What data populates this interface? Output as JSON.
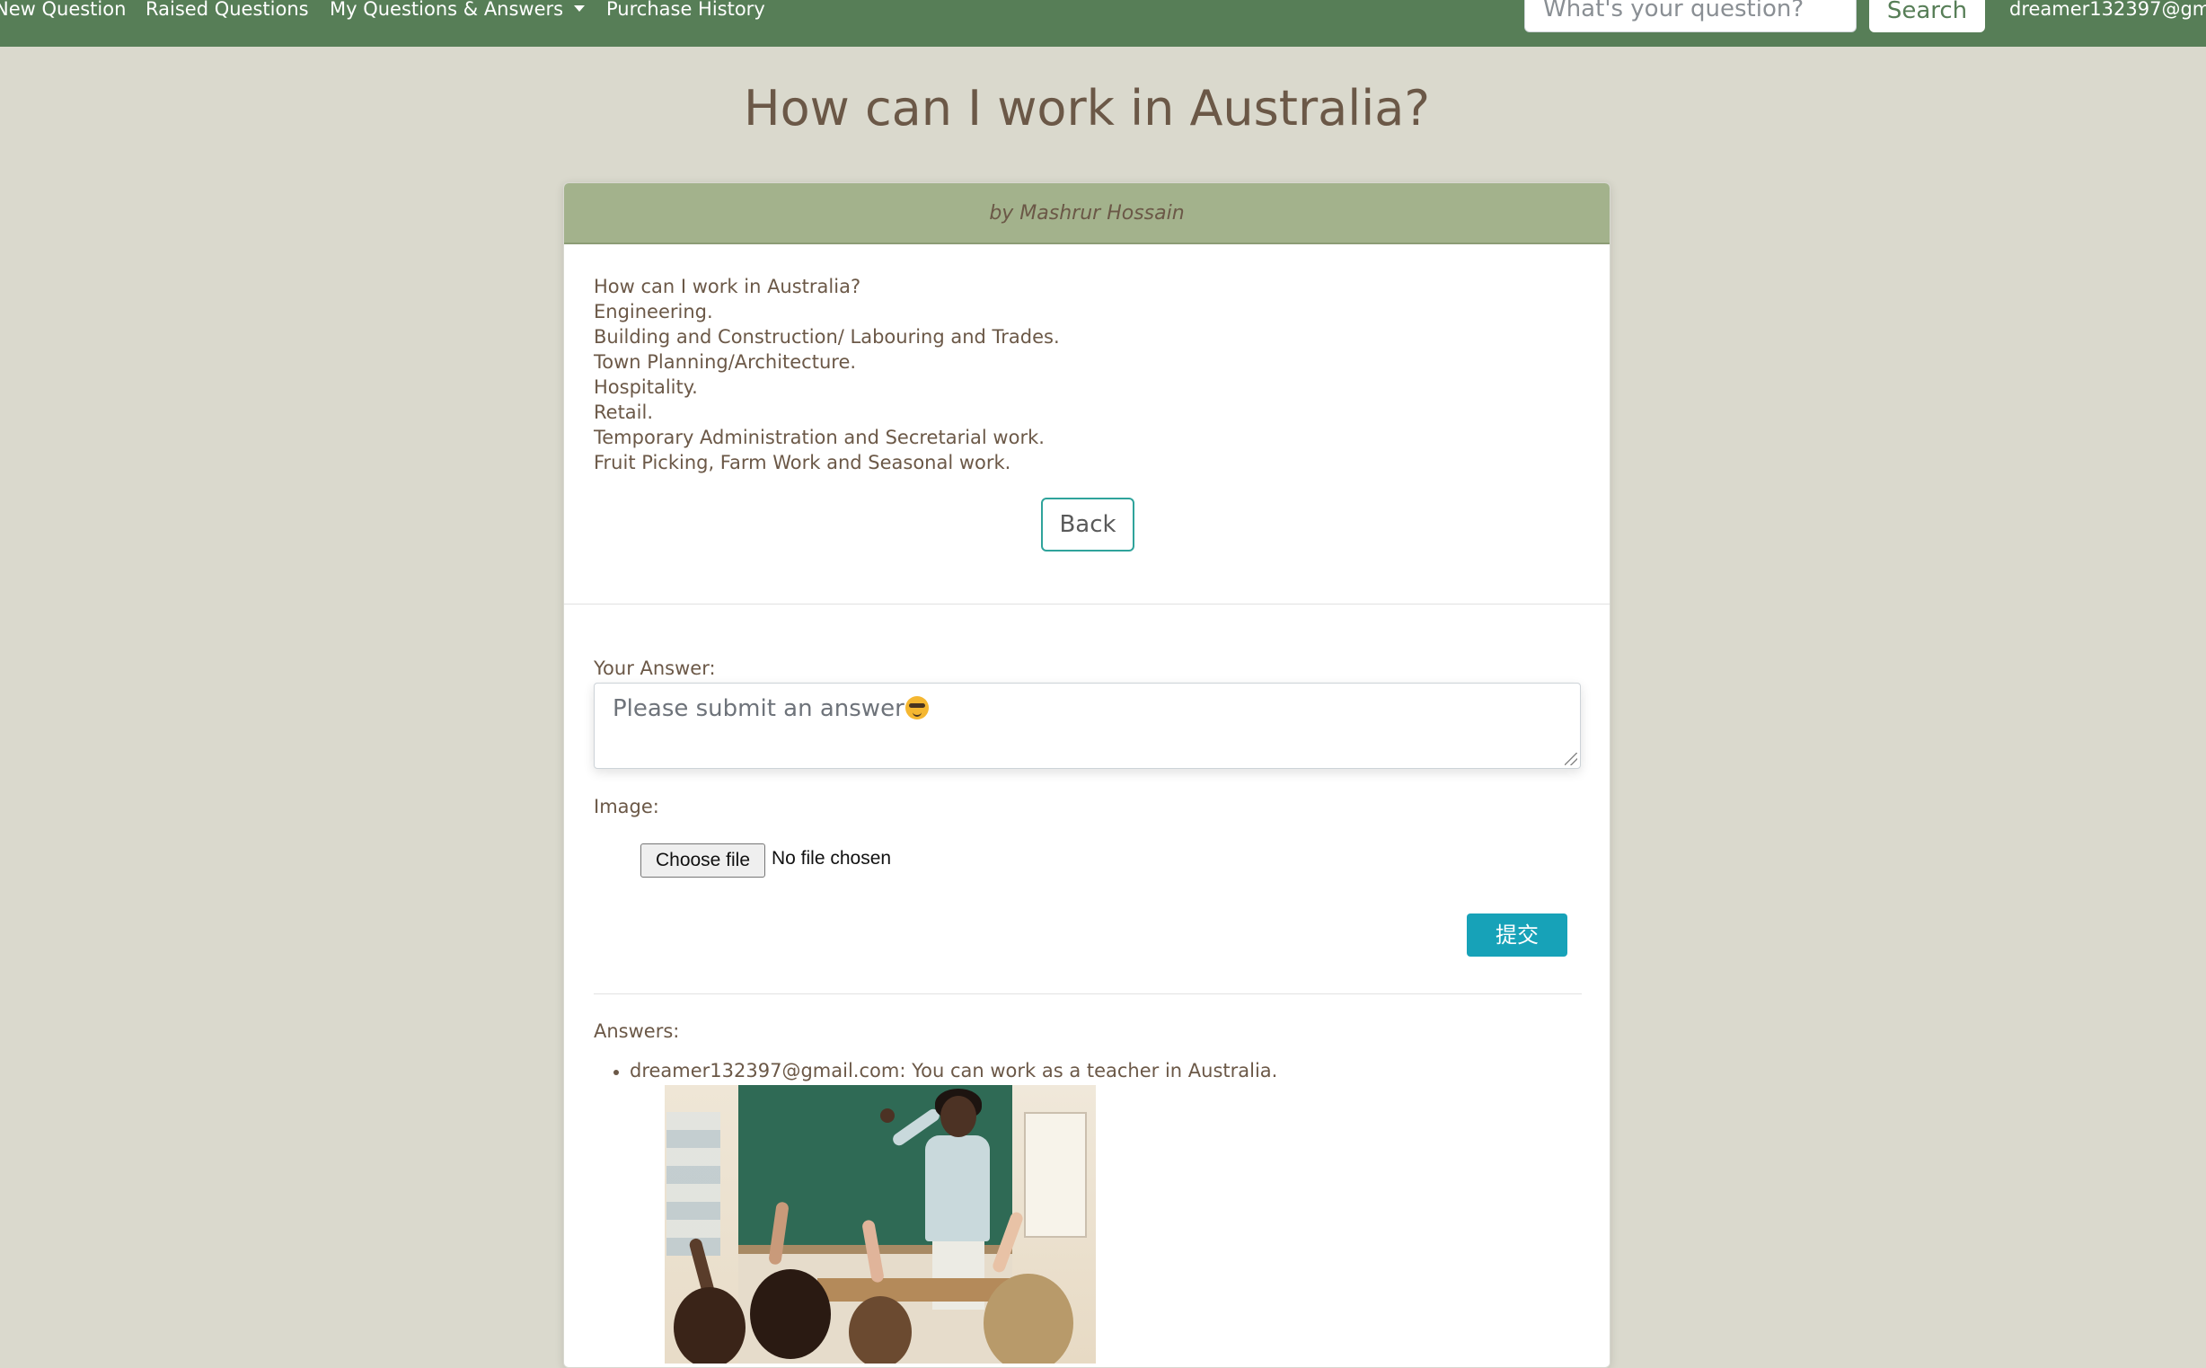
{
  "nav": {
    "links": [
      "New Question",
      "Raised Questions",
      "My Questions & Answers",
      "Purchase History"
    ],
    "search_placeholder": "What's your question?",
    "search_label": "Search",
    "user_email": "dreamer132397@gm"
  },
  "question": {
    "title": "How can I work in Australia?",
    "author": "by Mashrur Hossain",
    "body_lines": [
      "How can I work in Australia?",
      "Engineering.",
      "Building and Construction/ Labouring and Trades.",
      "Town Planning/Architecture.",
      "Hospitality.",
      "Retail.",
      "Temporary Administration and Secretarial work.",
      "Fruit Picking, Farm Work and Seasonal work."
    ],
    "back_label": "Back"
  },
  "answer_form": {
    "answer_label": "Your Answer:",
    "answer_placeholder": "Please submit an answer",
    "image_label": "Image:",
    "file_button_label": "Choose file",
    "file_status": "No file chosen",
    "submit_label": "提交"
  },
  "answers": {
    "heading": "Answers:",
    "items": [
      {
        "author": "dreamer132397@gmail.com",
        "text": "dreamer132397@gmail.com: You can work as a teacher in Australia."
      }
    ]
  },
  "colors": {
    "navbar": "#577e57",
    "page_bg": "#dad9cd",
    "card_header": "#a3b28c",
    "text": "#6b5847",
    "back_border": "#2fa39b",
    "submit": "#17a2b8"
  }
}
